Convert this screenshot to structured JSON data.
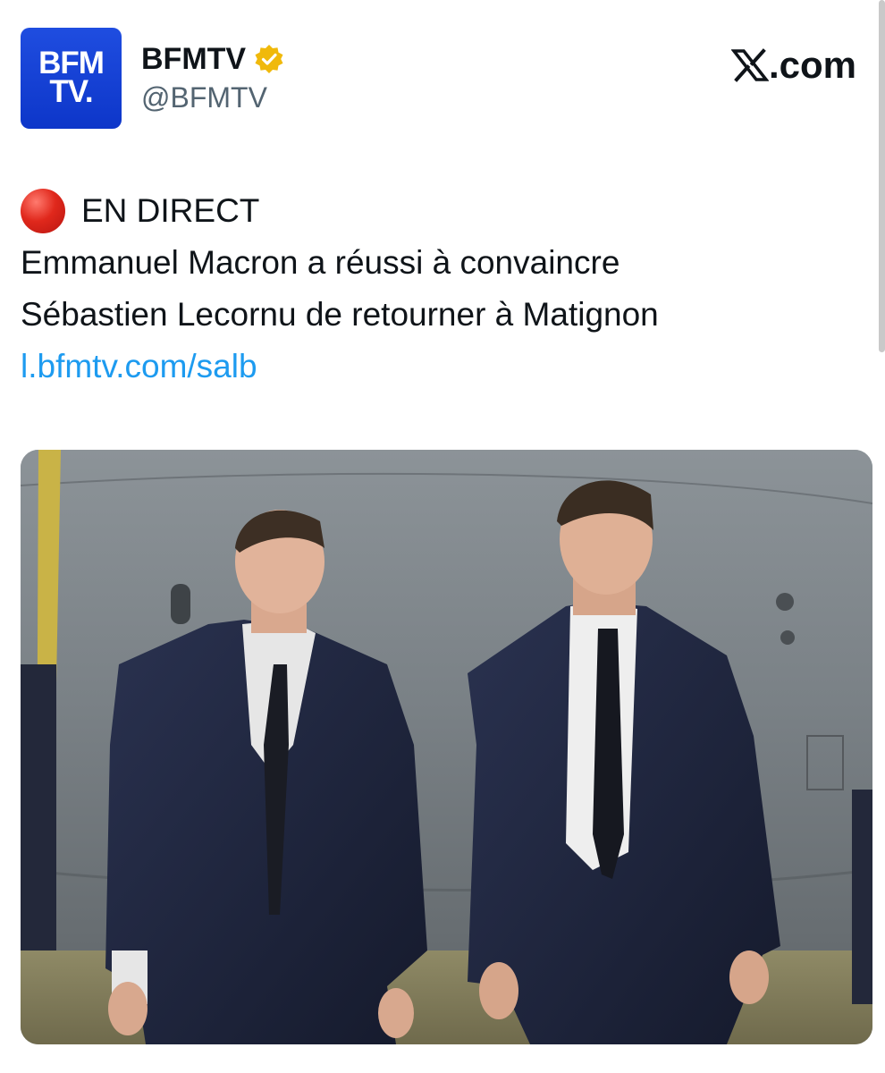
{
  "author": {
    "avatar_text_line1": "BFM",
    "avatar_text_line2": "TV.",
    "display_name": "BFMTV",
    "handle": "@BFMTV",
    "verified_icon": "verified-gold-badge-icon",
    "avatar_color": "#1a45d8"
  },
  "site": {
    "label": ".com",
    "logo_icon": "x-logo-icon"
  },
  "tweet": {
    "live_icon": "red-circle-icon",
    "live_label": "EN DIRECT",
    "headline_line1": "Emmanuel Macron a réussi à convaincre",
    "headline_line2": "Sébastien Lecornu de retourner à Matignon",
    "link": "l.bfmtv.com/salb"
  },
  "media": {
    "description_icon": "photo-two-men-in-suits-walking-near-aircraft"
  },
  "colors": {
    "text": "#0f1419",
    "secondary_text": "#536471",
    "link": "#1d9bf0",
    "live_red": "#e0281c",
    "verified_gold": "#f0b90b"
  }
}
